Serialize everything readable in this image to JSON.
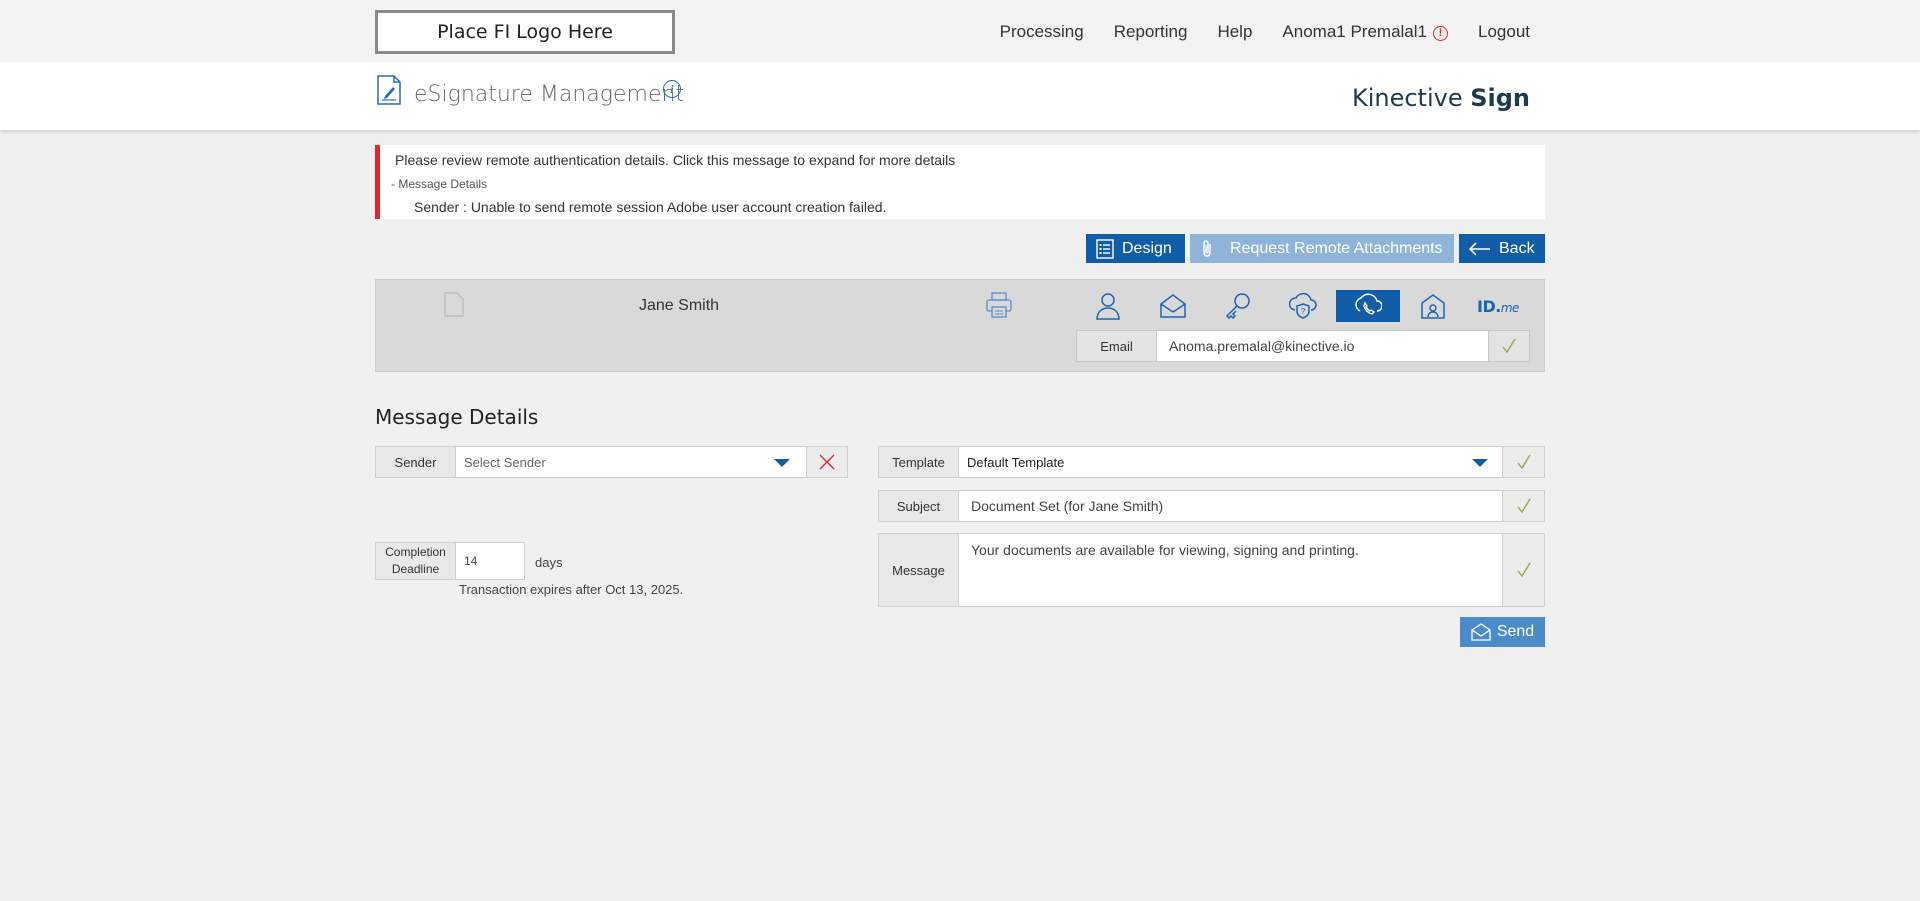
{
  "topbar": {
    "logo_text": "Place FI Logo Here",
    "nav": {
      "processing": "Processing",
      "reporting": "Reporting",
      "help": "Help",
      "user": "Anoma1 Premalal1",
      "logout": "Logout"
    }
  },
  "header": {
    "title": "eSignature Management",
    "brand_light": "Kinective ",
    "brand_bold": "Sign"
  },
  "alert": {
    "main": "Please review remote authentication details. Click this message to expand for more details",
    "details_toggle": "- Message Details",
    "sender_line": "Sender :  Unable to send remote session Adobe user account creation failed."
  },
  "actions": {
    "design": "Design",
    "request_attachments": "Request Remote Attachments",
    "back": "Back"
  },
  "signer": {
    "name": "Jane Smith",
    "auth_methods": [
      "person-icon",
      "email-icon",
      "key-icon",
      "question-shield-icon",
      "phone-icon",
      "building-icon",
      "idme-logo"
    ],
    "active_method": "phone-icon",
    "idme_main": "ID.",
    "idme_sub": "me",
    "email_label": "Email",
    "email_value": "Anoma.premalal@kinective.io"
  },
  "message_details": {
    "title": "Message Details",
    "sender_label": "Sender",
    "sender_placeholder": "Select Sender",
    "deadline_label": "Completion Deadline",
    "deadline_value": "14",
    "days_label": "days",
    "expires_text": "Transaction expires after Oct 13, 2025.",
    "template_label": "Template",
    "template_value": "Default Template",
    "subject_label": "Subject",
    "subject_value": "Document Set (for Jane Smith)",
    "message_label": "Message",
    "message_value": "Your documents are available for viewing, signing and printing.",
    "send": "Send"
  },
  "colors": {
    "primary": "#115da8",
    "disabled": "#8fb4da",
    "error": "#e3262b",
    "check": "#8ab04a"
  }
}
